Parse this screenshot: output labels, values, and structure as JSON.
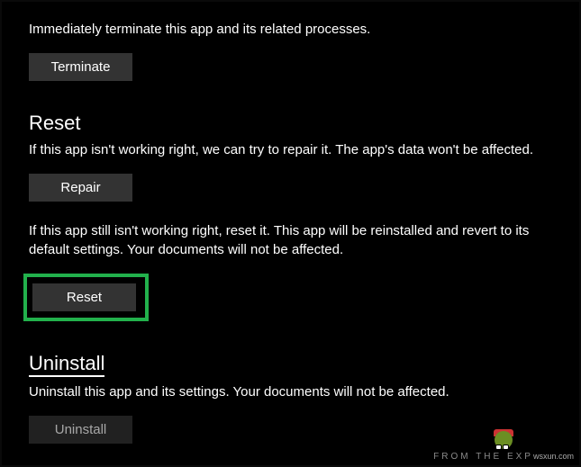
{
  "terminate": {
    "description": "Immediately terminate this app and its related processes.",
    "button_label": "Terminate"
  },
  "reset": {
    "heading": "Reset",
    "repair_description": "If this app isn't working right, we can try to repair it. The app's data won't be affected.",
    "repair_button_label": "Repair",
    "reset_description": "If this app still isn't working right, reset it. This app will be reinstalled and revert to its default settings. Your documents will not be affected.",
    "reset_button_label": "Reset"
  },
  "uninstall": {
    "heading": "Uninstall",
    "description": "Uninstall this app and its settings. Your documents will not be affected.",
    "button_label": "Uninstall"
  },
  "watermark": "FROM THE EXP",
  "watermark_suffix": "wsxun.com"
}
